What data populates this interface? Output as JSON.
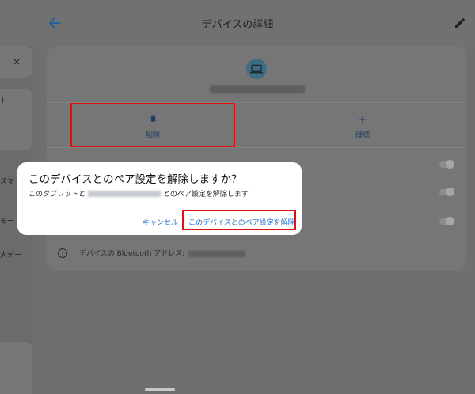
{
  "header": {
    "title": "デバイスの詳細",
    "back_icon": "arrow-left-icon",
    "edit_icon": "pencil-icon"
  },
  "left_panel": {
    "close_glyph": "×",
    "fragments": [
      "ト",
      "スマ",
      "モー",
      "人デー"
    ]
  },
  "device": {
    "icon": "laptop-icon"
  },
  "actions": {
    "delete": {
      "glyph": "🗑",
      "label": "削除",
      "icon": "trash-icon"
    },
    "connect": {
      "glyph": "+",
      "label": "接続",
      "icon": "plus-icon"
    }
  },
  "details": {
    "bluetooth_address_label": "デバイスの Bluetooth アドレス:"
  },
  "dialog": {
    "title": "このデバイスとのペア設定を解除しますか？",
    "message_prefix": "このタブレットと",
    "message_suffix": "とのペア設定を解除します",
    "cancel_label": "キャンセル",
    "confirm_label": "このデバイスとのペア設定を解除"
  },
  "colors": {
    "accent": "#1f6fd1",
    "highlight": "#e01010",
    "scrim": "#6f6f6f"
  }
}
